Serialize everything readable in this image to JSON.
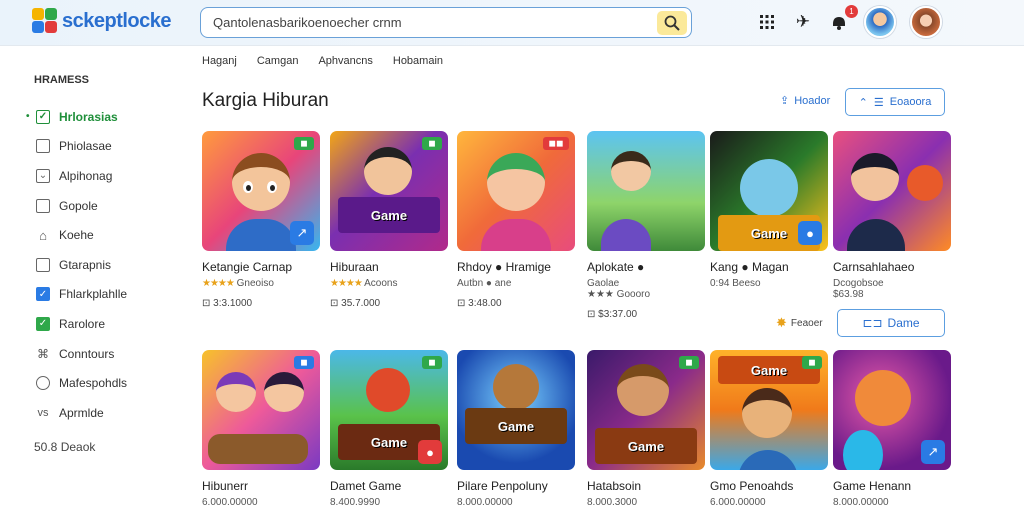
{
  "header": {
    "logo_text": "sckeptlocke",
    "search_value": "Qantolenasbarikoenoecher crnm",
    "notification_count": "1",
    "icons": [
      "grid-icon",
      "controller-icon",
      "notification-icon",
      "user-avatar",
      "profile-avatar"
    ]
  },
  "sidebar": {
    "heading": "HRAMESS",
    "items": [
      {
        "label": "Hrlorasias",
        "icon": "check",
        "active": true
      },
      {
        "label": "Phiolasae",
        "icon": "box"
      },
      {
        "label": "Alpihonag",
        "icon": "box"
      },
      {
        "label": "Gopole",
        "icon": "box"
      },
      {
        "label": "Koehe",
        "icon": "home"
      },
      {
        "label": "Gtarapnis",
        "icon": "box"
      },
      {
        "label": "Fhlarkplahlle",
        "icon": "check-blue"
      },
      {
        "label": "Rarolore",
        "icon": "check-green"
      },
      {
        "label": "Conntours",
        "icon": "box"
      },
      {
        "label": "Mafespohdls",
        "icon": "circle"
      },
      {
        "label": "Aprmlde",
        "icon": "text"
      }
    ],
    "footer": "50.8 Deaok"
  },
  "subnav": [
    "Haganj",
    "Camgan",
    "Aphvancns",
    "Hobamain"
  ],
  "section": {
    "title": "Kargia Hiburan",
    "link_label": "Hoador",
    "button_label": "Eoaoora"
  },
  "row1": [
    {
      "title": "Ketangie Carnap",
      "meta": "Gneoiso",
      "price": "3:3.1000",
      "corner": "g"
    },
    {
      "title": "Hiburaan",
      "meta": "Acoons",
      "price": "35.7.000",
      "corner": "g"
    },
    {
      "title": "Rhdoy ● Hramige",
      "meta": "Autbn ● ane",
      "price": "3:48.00",
      "corner": "r"
    },
    {
      "title": "Aplokate ●",
      "meta": "Gaolae\n★★★ Goooro",
      "price": "$3:37.00",
      "corner": ""
    },
    {
      "title": "Kang ● Magan",
      "meta": "0:94 Beeso",
      "price": "",
      "corner": ""
    },
    {
      "title": "Carnsahlahaeo",
      "meta": "Dcogobsoe\n$63.98",
      "price": "",
      "corner": ""
    }
  ],
  "row2": [
    {
      "title": "Hibunerr",
      "meta": "6.000.00000",
      "corner": "b"
    },
    {
      "title": "Damet Game",
      "meta": "8.400.9990",
      "corner": "g"
    },
    {
      "title": "Pilare Penpoluny",
      "meta": "8.000.00000",
      "corner": ""
    },
    {
      "title": "Hatabsoin",
      "meta": "8.000.3000",
      "corner": "g"
    },
    {
      "title": "Gmo Penoahds",
      "meta": "6.000.00000",
      "corner": "g"
    },
    {
      "title": "Game Henann",
      "meta": "8.000.00000",
      "corner": ""
    }
  ],
  "feature_link": "Feaoer",
  "card_button": "Dame",
  "colors": {
    "accent": "#2a6fcf",
    "active": "#1f8f3a",
    "search_btn": "#fbe99a"
  }
}
